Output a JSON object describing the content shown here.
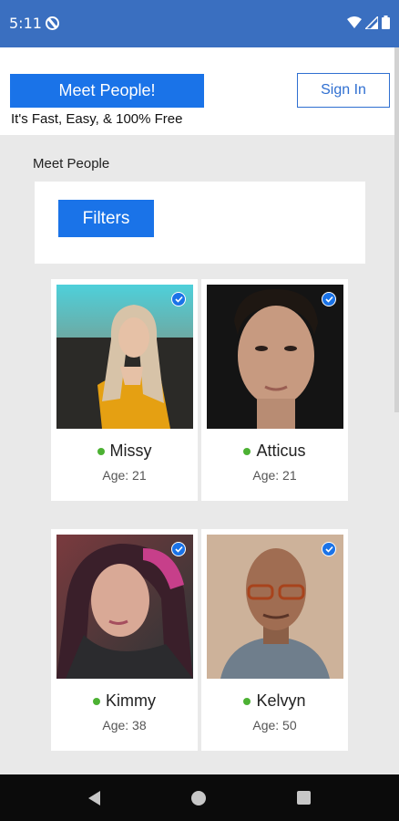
{
  "status_bar": {
    "time": "5:11"
  },
  "header": {
    "meet_button": "Meet People!",
    "tagline": "It's Fast, Easy, & 100% Free",
    "signin_button": "Sign In"
  },
  "section_title": "Meet People",
  "filters_button": "Filters",
  "profiles": [
    {
      "name": "Missy",
      "age": "Age: 21",
      "verified": true,
      "online": true
    },
    {
      "name": "Atticus",
      "age": "Age: 21",
      "verified": true,
      "online": true
    },
    {
      "name": "Kimmy",
      "age": "Age: 38",
      "verified": true,
      "online": true
    },
    {
      "name": "Kelvyn",
      "age": "Age: 50",
      "verified": true,
      "online": true
    }
  ],
  "colors": {
    "accent": "#1a73e8",
    "status_bar": "#3a6fc0",
    "online": "#4cb133"
  }
}
